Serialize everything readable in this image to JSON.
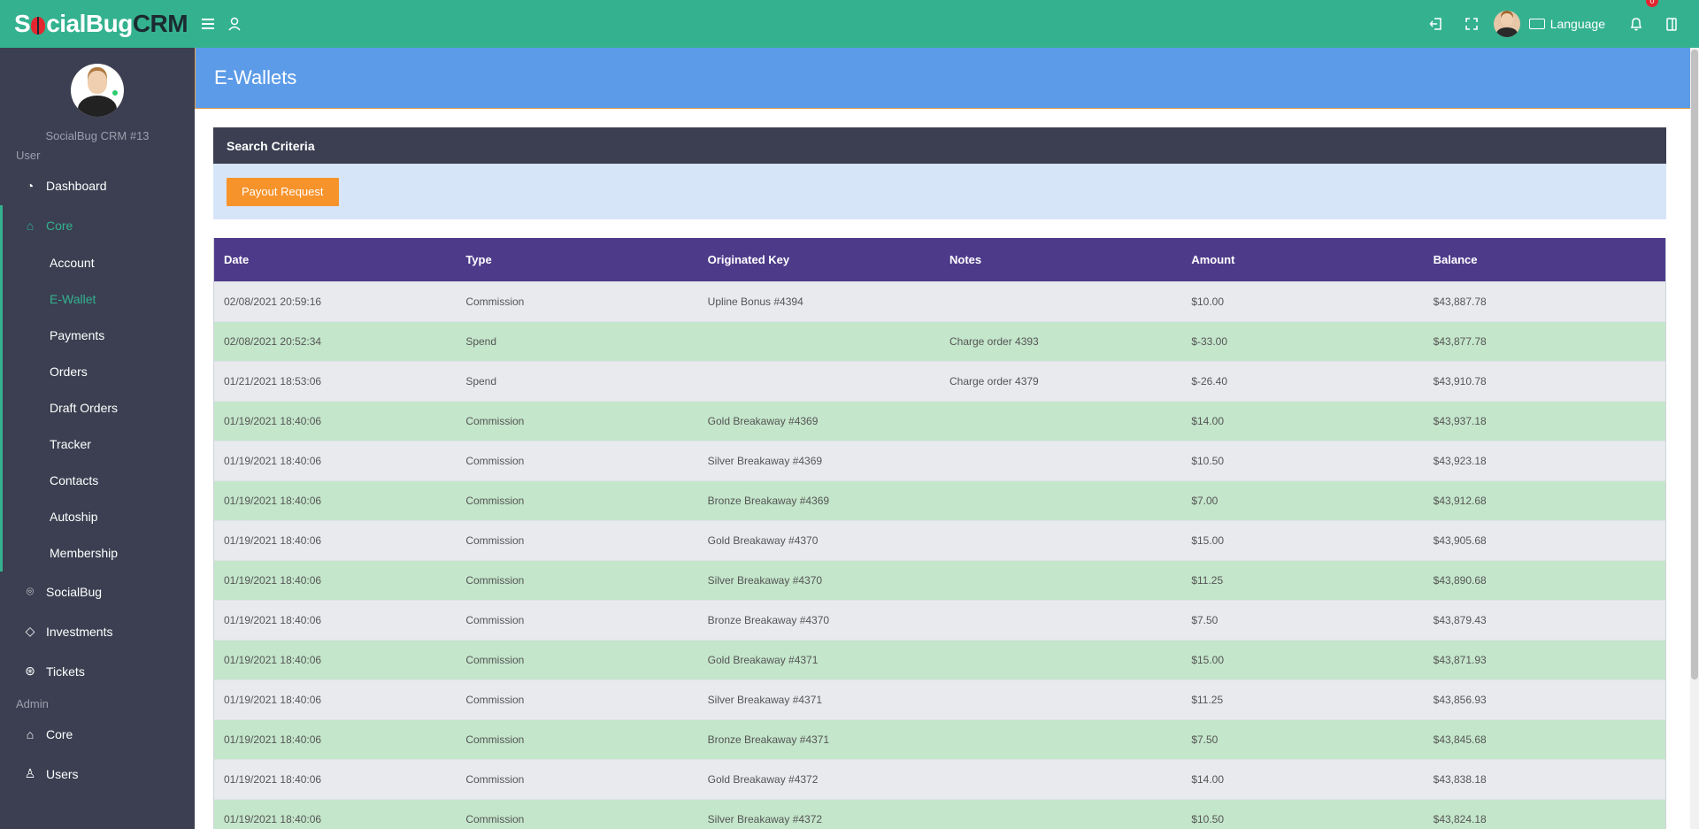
{
  "topbar": {
    "logo_part1": "S",
    "logo_part2": "cial",
    "logo_part3": "Bug",
    "logo_part4": "CRM",
    "language_label": "Language",
    "notification_count": "0"
  },
  "sidebar": {
    "profile_name": "SocialBug CRM #13",
    "user_section_label": "User",
    "admin_section_label": "Admin",
    "dashboard": "Dashboard",
    "core": "Core",
    "core_items": [
      "Account",
      "E-Wallet",
      "Payments",
      "Orders",
      "Draft Orders",
      "Tracker",
      "Contacts",
      "Autoship",
      "Membership"
    ],
    "socialbug": "SocialBug",
    "investments": "Investments",
    "tickets": "Tickets",
    "admin_core": "Core",
    "admin_users": "Users"
  },
  "page": {
    "title": "E-Wallets",
    "search_criteria": "Search Criteria",
    "payout_button": "Payout Request"
  },
  "table": {
    "headers": [
      "Date",
      "Type",
      "Originated Key",
      "Notes",
      "Amount",
      "Balance"
    ],
    "rows": [
      [
        "02/08/2021 20:59:16",
        "Commission",
        "Upline Bonus #4394",
        "",
        "$10.00",
        "$43,887.78"
      ],
      [
        "02/08/2021 20:52:34",
        "Spend",
        "",
        "Charge order 4393",
        "$-33.00",
        "$43,877.78"
      ],
      [
        "01/21/2021 18:53:06",
        "Spend",
        "",
        "Charge order 4379",
        "$-26.40",
        "$43,910.78"
      ],
      [
        "01/19/2021 18:40:06",
        "Commission",
        "Gold Breakaway #4369",
        "",
        "$14.00",
        "$43,937.18"
      ],
      [
        "01/19/2021 18:40:06",
        "Commission",
        "Silver Breakaway #4369",
        "",
        "$10.50",
        "$43,923.18"
      ],
      [
        "01/19/2021 18:40:06",
        "Commission",
        "Bronze Breakaway #4369",
        "",
        "$7.00",
        "$43,912.68"
      ],
      [
        "01/19/2021 18:40:06",
        "Commission",
        "Gold Breakaway #4370",
        "",
        "$15.00",
        "$43,905.68"
      ],
      [
        "01/19/2021 18:40:06",
        "Commission",
        "Silver Breakaway #4370",
        "",
        "$11.25",
        "$43,890.68"
      ],
      [
        "01/19/2021 18:40:06",
        "Commission",
        "Bronze Breakaway #4370",
        "",
        "$7.50",
        "$43,879.43"
      ],
      [
        "01/19/2021 18:40:06",
        "Commission",
        "Gold Breakaway #4371",
        "",
        "$15.00",
        "$43,871.93"
      ],
      [
        "01/19/2021 18:40:06",
        "Commission",
        "Silver Breakaway #4371",
        "",
        "$11.25",
        "$43,856.93"
      ],
      [
        "01/19/2021 18:40:06",
        "Commission",
        "Bronze Breakaway #4371",
        "",
        "$7.50",
        "$43,845.68"
      ],
      [
        "01/19/2021 18:40:06",
        "Commission",
        "Gold Breakaway #4372",
        "",
        "$14.00",
        "$43,838.18"
      ],
      [
        "01/19/2021 18:40:06",
        "Commission",
        "Silver Breakaway #4372",
        "",
        "$10.50",
        "$43,824.18"
      ]
    ]
  },
  "colors": {
    "topbar": "#34b290",
    "sidebar": "#3b3f51",
    "header": "#5c9be8",
    "table_header": "#4d3b8a",
    "row_alt": "#c4e6cb",
    "button": "#f7932b"
  }
}
